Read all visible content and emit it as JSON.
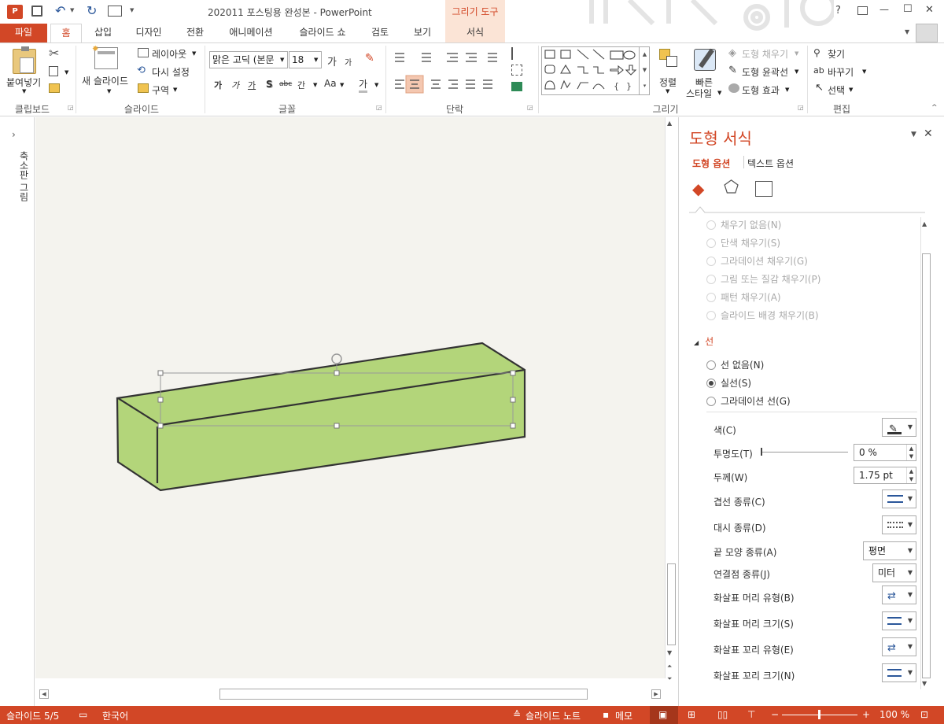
{
  "window": {
    "title": "202011 포스팅용 완성본 - PowerPoint",
    "context_tab_header": "그리기 도구",
    "help": "?",
    "minimize": "—",
    "maximize": "☐",
    "close": "✕"
  },
  "tabs": [
    "파일",
    "홈",
    "삽입",
    "디자인",
    "전환",
    "애니메이션",
    "슬라이드 쇼",
    "검토",
    "보기",
    "서식"
  ],
  "ribbon": {
    "clipboard": {
      "paste": "붙여넣기",
      "label": "클립보드"
    },
    "slides": {
      "new_slide": "새 슬라이드",
      "layout": "레이아웃",
      "reset": "다시 설정",
      "section": "구역",
      "label": "슬라이드"
    },
    "font": {
      "font_name": "맑은 고딕 (본문",
      "font_size": "18",
      "label": "글꼴",
      "grow": "가",
      "shrink": "가",
      "bold": "가",
      "italic": "가",
      "underline": "가",
      "shadow": "S",
      "strike": "abc",
      "spacing": "간",
      "case": "Aa",
      "color": "가"
    },
    "paragraph": {
      "label": "단락"
    },
    "drawing": {
      "arrange": "정렬",
      "quick_styles_1": "빠른",
      "quick_styles_2": "스타일",
      "fill": "도형 채우기",
      "outline": "도형 윤곽선",
      "effects": "도형 효과",
      "label": "그리기"
    },
    "editing": {
      "find": "찾기",
      "replace": "바꾸기",
      "select": "선택",
      "label": "편집"
    }
  },
  "left_panel": {
    "label": "축소판 그림"
  },
  "pane": {
    "title": "도형 서식",
    "tab_shape": "도형 옵션",
    "tab_text": "텍스트 옵션",
    "fill_options": [
      "채우기 없음(N)",
      "단색 채우기(S)",
      "그라데이션 채우기(G)",
      "그림 또는 질감 채우기(P)",
      "패턴 채우기(A)",
      "슬라이드 배경 채우기(B)"
    ],
    "line_section": "선",
    "line_options": [
      "선 없음(N)",
      "실선(S)",
      "그라데이션 선(G)"
    ],
    "color_label": "색(C)",
    "transparency_label": "투명도(T)",
    "transparency_value": "0 %",
    "width_label": "두께(W)",
    "width_value": "1.75 pt",
    "compound_label": "겹선 종류(C)",
    "dash_label": "대시 종류(D)",
    "cap_label": "끝 모양 종류(A)",
    "cap_value": "평면",
    "join_label": "연결점 종류(J)",
    "join_value": "미터",
    "begin_arrow_type": "화살표 머리 유형(B)",
    "begin_arrow_size": "화살표 머리 크기(S)",
    "end_arrow_type": "화살표 꼬리 유형(E)",
    "end_arrow_size": "화살표 꼬리 크기(N)"
  },
  "status": {
    "slide": "슬라이드 5/5",
    "language": "한국어",
    "notes": "슬라이드 노트",
    "comments": "메모",
    "zoom": "100 %"
  },
  "colors": {
    "accent": "#d24726",
    "shape_fill": "#b3d57a",
    "shape_stroke": "#333333",
    "slide_bg": "#f4f3ee"
  }
}
